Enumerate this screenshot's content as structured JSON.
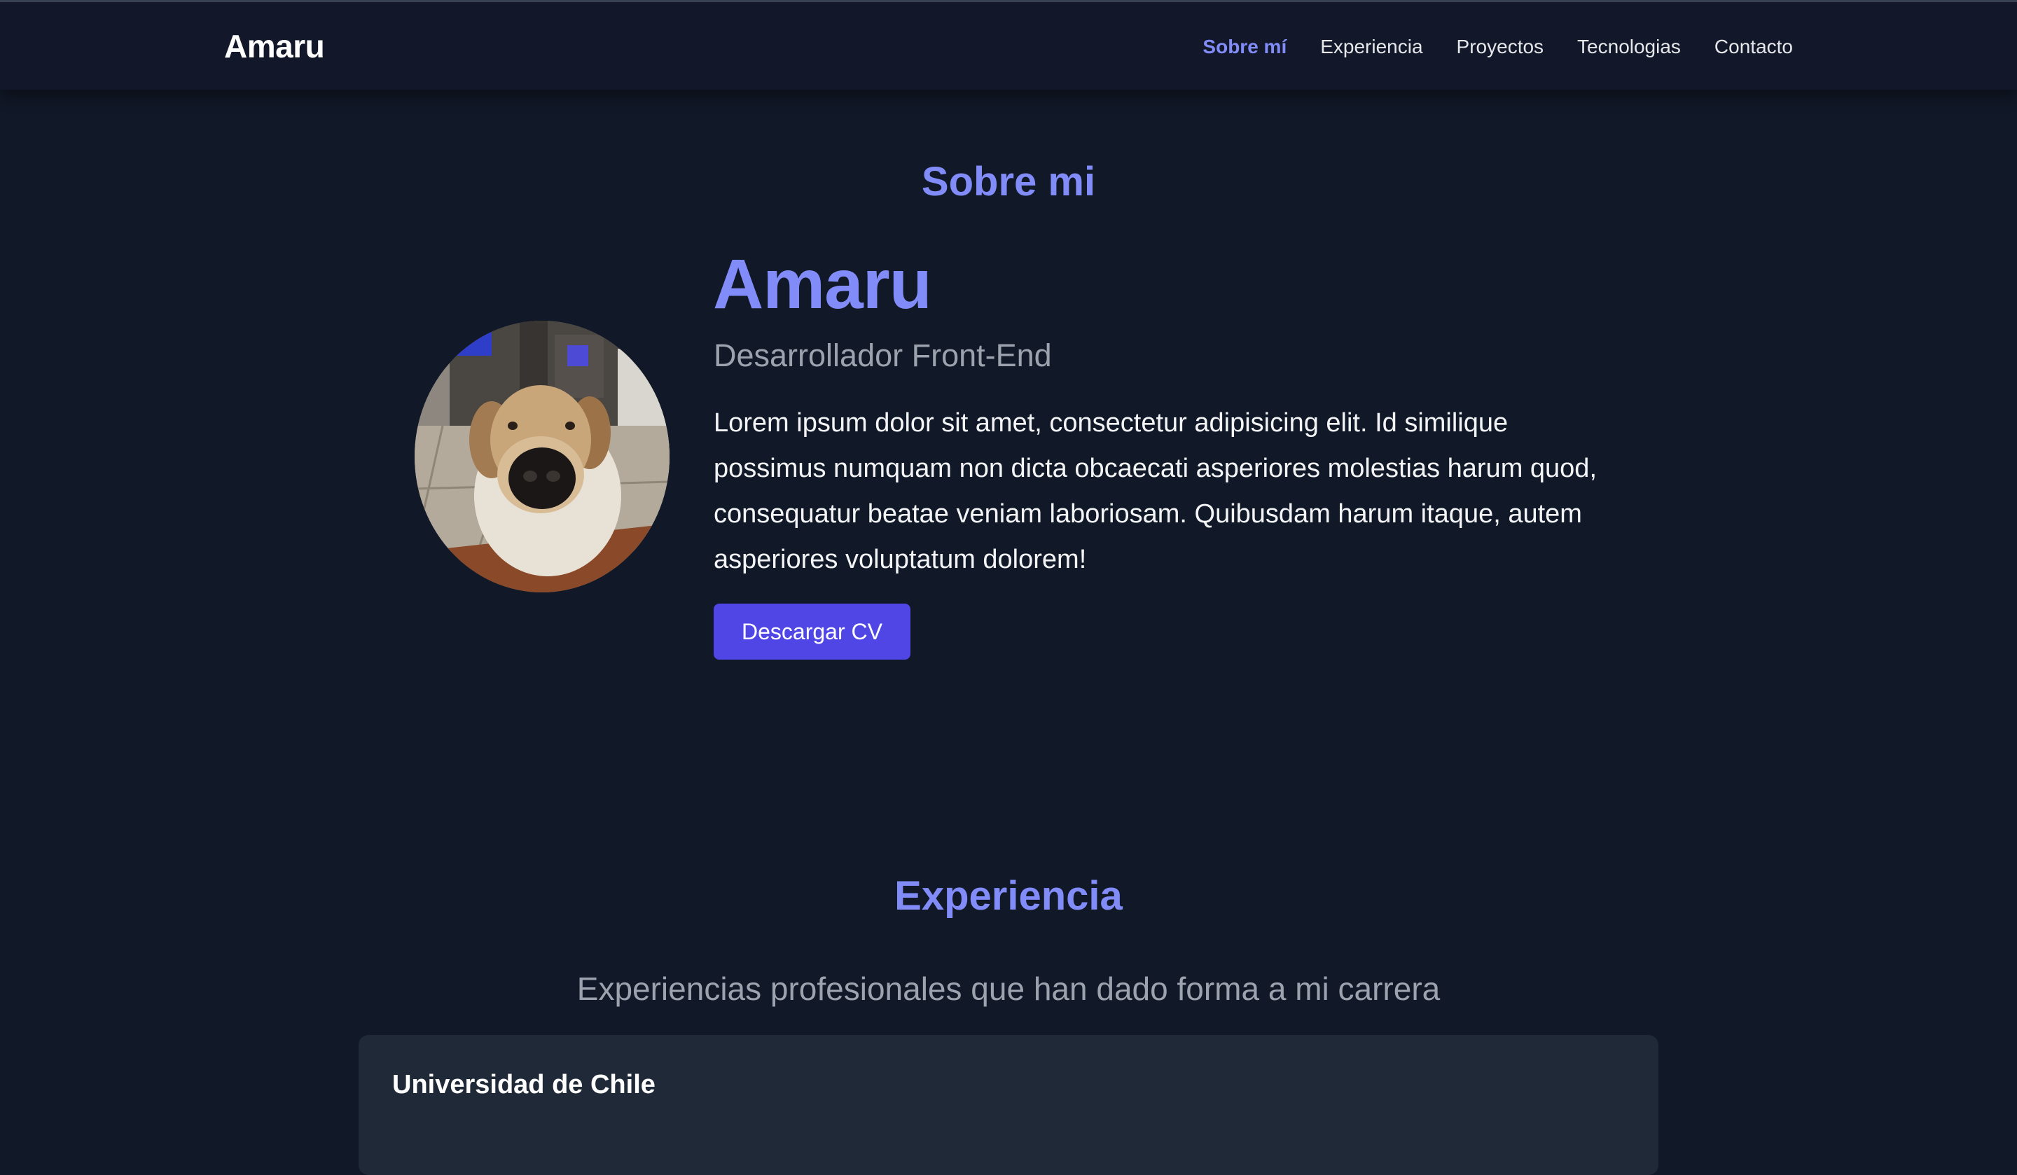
{
  "brand": "Amaru",
  "nav": {
    "items": [
      {
        "label": "Sobre mí",
        "active": true
      },
      {
        "label": "Experiencia",
        "active": false
      },
      {
        "label": "Proyectos",
        "active": false
      },
      {
        "label": "Tecnologias",
        "active": false
      },
      {
        "label": "Contacto",
        "active": false
      }
    ]
  },
  "about": {
    "title": "Sobre mi",
    "name": "Amaru",
    "role": "Desarrollador Front-End",
    "bio": "Lorem ipsum dolor sit amet, consectetur adipisicing elit. Id similique possimus numquam non dicta obcaecati asperiores molestias harum quod, consequatur beatae veniam laboriosam. Quibusdam harum itaque, autem asperiores voluptatum dolorem!",
    "cv_button": "Descargar CV"
  },
  "experience": {
    "title": "Experiencia",
    "subtitle": "Experiencias profesionales que han dado forma a mi carrera",
    "cards": [
      {
        "title": "Universidad de Chile"
      }
    ]
  },
  "colors": {
    "background": "#111827",
    "navbar": "#121829",
    "accent": "#818cf8",
    "button": "#4f46e5",
    "muted_text": "#9ca3af",
    "card": "#1f2937"
  }
}
